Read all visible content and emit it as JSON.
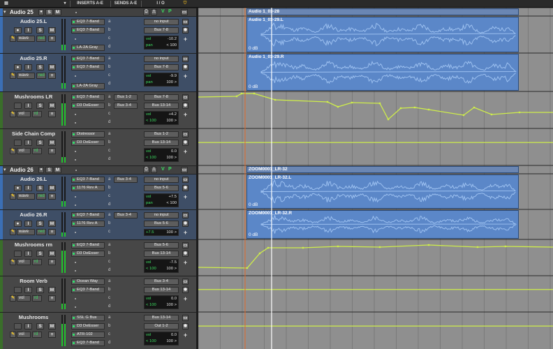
{
  "header": {
    "inserts_label": "INSERTS A-E",
    "sends_label": "SENDS A-E",
    "io_label": "I / O"
  },
  "colors": {
    "track_blue": "#3b6fb5",
    "track_green": "#3a6e2a",
    "automation_line": "#cfee4a",
    "clip_fill": "#5b87c8",
    "waveform": "#9cc0f0",
    "playhead_orange": "#e06a2a",
    "cursor_white": "#ffffff"
  },
  "folders": [
    {
      "name": "Audio 25",
      "clip_name": "Audio 1_03-28"
    },
    {
      "name": "Audio 26",
      "clip_name": "ZOOM0001_LR-32"
    }
  ],
  "tracks": [
    {
      "name": "Audio 25.L",
      "inserts": [
        "EQ3 7-Band",
        "EQ3 7-Band",
        "",
        "",
        "LA-2A Gray"
      ],
      "sends": [
        "",
        "",
        "",
        "",
        ""
      ],
      "input": "no input",
      "output": "Bus 7-8",
      "vol": "-10.2",
      "pan": "< 100",
      "clip": "Audio 1_03-29.L",
      "clip_db": "0 dB",
      "vol_label": "vol",
      "pan_label": "pan",
      "mode": "wave",
      "mode_rec": "red"
    },
    {
      "name": "Audio 25.R",
      "inserts": [
        "EQ3 7-Band",
        "EQ3 7-Band",
        "",
        "",
        "LA-2A Gray"
      ],
      "sends": [
        "",
        "",
        "",
        "",
        ""
      ],
      "input": "no input",
      "output": "Bus 7-8",
      "vol": "-9.9",
      "pan": "100 >",
      "clip": "Audio 1_03-29.R",
      "clip_db": "0 dB",
      "vol_label": "vol",
      "pan_label": "pan",
      "mode": "wave",
      "mode_rec": "red"
    },
    {
      "name": "Mushrooms LR",
      "inserts": [
        "EQ3 7-Band",
        "D3 DeEsser",
        "",
        "",
        ""
      ],
      "sends": [
        "Bus 1-2",
        "Bus 3-4",
        "",
        "",
        ""
      ],
      "input": "Bus 7-8",
      "output": "Bus 13-14",
      "vol": "+4.2",
      "pan_l": "< 100",
      "pan_r": "100 >",
      "vol_label": "vol",
      "mode": "vol",
      "mode_rec": "rd"
    },
    {
      "name": "Side Chain Comp",
      "inserts": [
        "Distressor",
        "D3 DeEsser",
        "",
        "",
        ""
      ],
      "sends": [
        "",
        "",
        "",
        "",
        ""
      ],
      "input": "Bus 1-2",
      "output": "Bus 13-14",
      "vol": "0.0",
      "pan_l": "< 100",
      "pan_r": "100 >",
      "vol_label": "vol",
      "mode": "vol",
      "mode_rec": "rd"
    },
    {
      "name": "Audio 26.L",
      "inserts": [
        "EQ3 7-Band",
        "1176 Rev A",
        "",
        "",
        ""
      ],
      "sends": [
        "Bus 3-4",
        "",
        "",
        "",
        ""
      ],
      "input": "no input",
      "output": "Bus 5-6",
      "vol": "+7.5",
      "pan": "< 100",
      "clip": "ZOOM0001_LR-32.L",
      "clip_db": "0 dB",
      "vol_label": "vol",
      "pan_label": "pan",
      "mode": "wave",
      "mode_rec": "red"
    },
    {
      "name": "Audio 26.R",
      "inserts": [
        "EQ3 7-Band",
        "1176 Rev A",
        "",
        "",
        ""
      ],
      "sends": [
        "Bus 3-4",
        "",
        "",
        "",
        ""
      ],
      "input": "no input",
      "output": "Bus 5-6",
      "vol_val": "+7.5",
      "pan_val": "100 >",
      "clip": "ZOOM0001_LR-32.R",
      "clip_db": "0 dB",
      "mode": "wave",
      "mode_rec": "red"
    },
    {
      "name": "Mushrooms rm",
      "inserts": [
        "EQ3 7-Band",
        "D3 DeEsser",
        "",
        "",
        ""
      ],
      "sends": [
        "",
        "",
        "",
        "",
        ""
      ],
      "input": "Bus 5-6",
      "output": "Bus 13-14",
      "vol": "-7.5",
      "pan_l": "< 100",
      "pan_r": "100 >",
      "vol_label": "vol",
      "mode": "vol",
      "mode_rec": "rd"
    },
    {
      "name": "Room Verb",
      "inserts": [
        "Ocean Way",
        "EQ3 7-Band",
        "",
        "",
        ""
      ],
      "sends": [
        "",
        "",
        "",
        "",
        ""
      ],
      "input": "Bus 3-4",
      "output": "Bus 13-14",
      "vol": "0.0",
      "pan_l": "< 100",
      "pan_r": "100 >",
      "vol_label": "vol",
      "mode": "vol",
      "mode_rec": "rd"
    },
    {
      "name": "Mushrooms",
      "inserts": [
        "SSL G Bus",
        "D3 DeEsser",
        "ATR-102",
        "EQ3 7-Band",
        ""
      ],
      "sends": [
        "",
        "",
        "",
        "",
        ""
      ],
      "input": "Bus 13-14",
      "output": "Out 1-2",
      "vol": "0.0",
      "pan_l": "< 100",
      "pan_r": "100 >",
      "vol_label": "vol",
      "mode": "vol",
      "mode_rec": "rd"
    }
  ],
  "slot_letters": [
    "a",
    "b",
    "c",
    "d"
  ],
  "button_labels": {
    "solo": "S",
    "mute": "M",
    "record": "I",
    "view": "V",
    "pan_p": "P"
  }
}
